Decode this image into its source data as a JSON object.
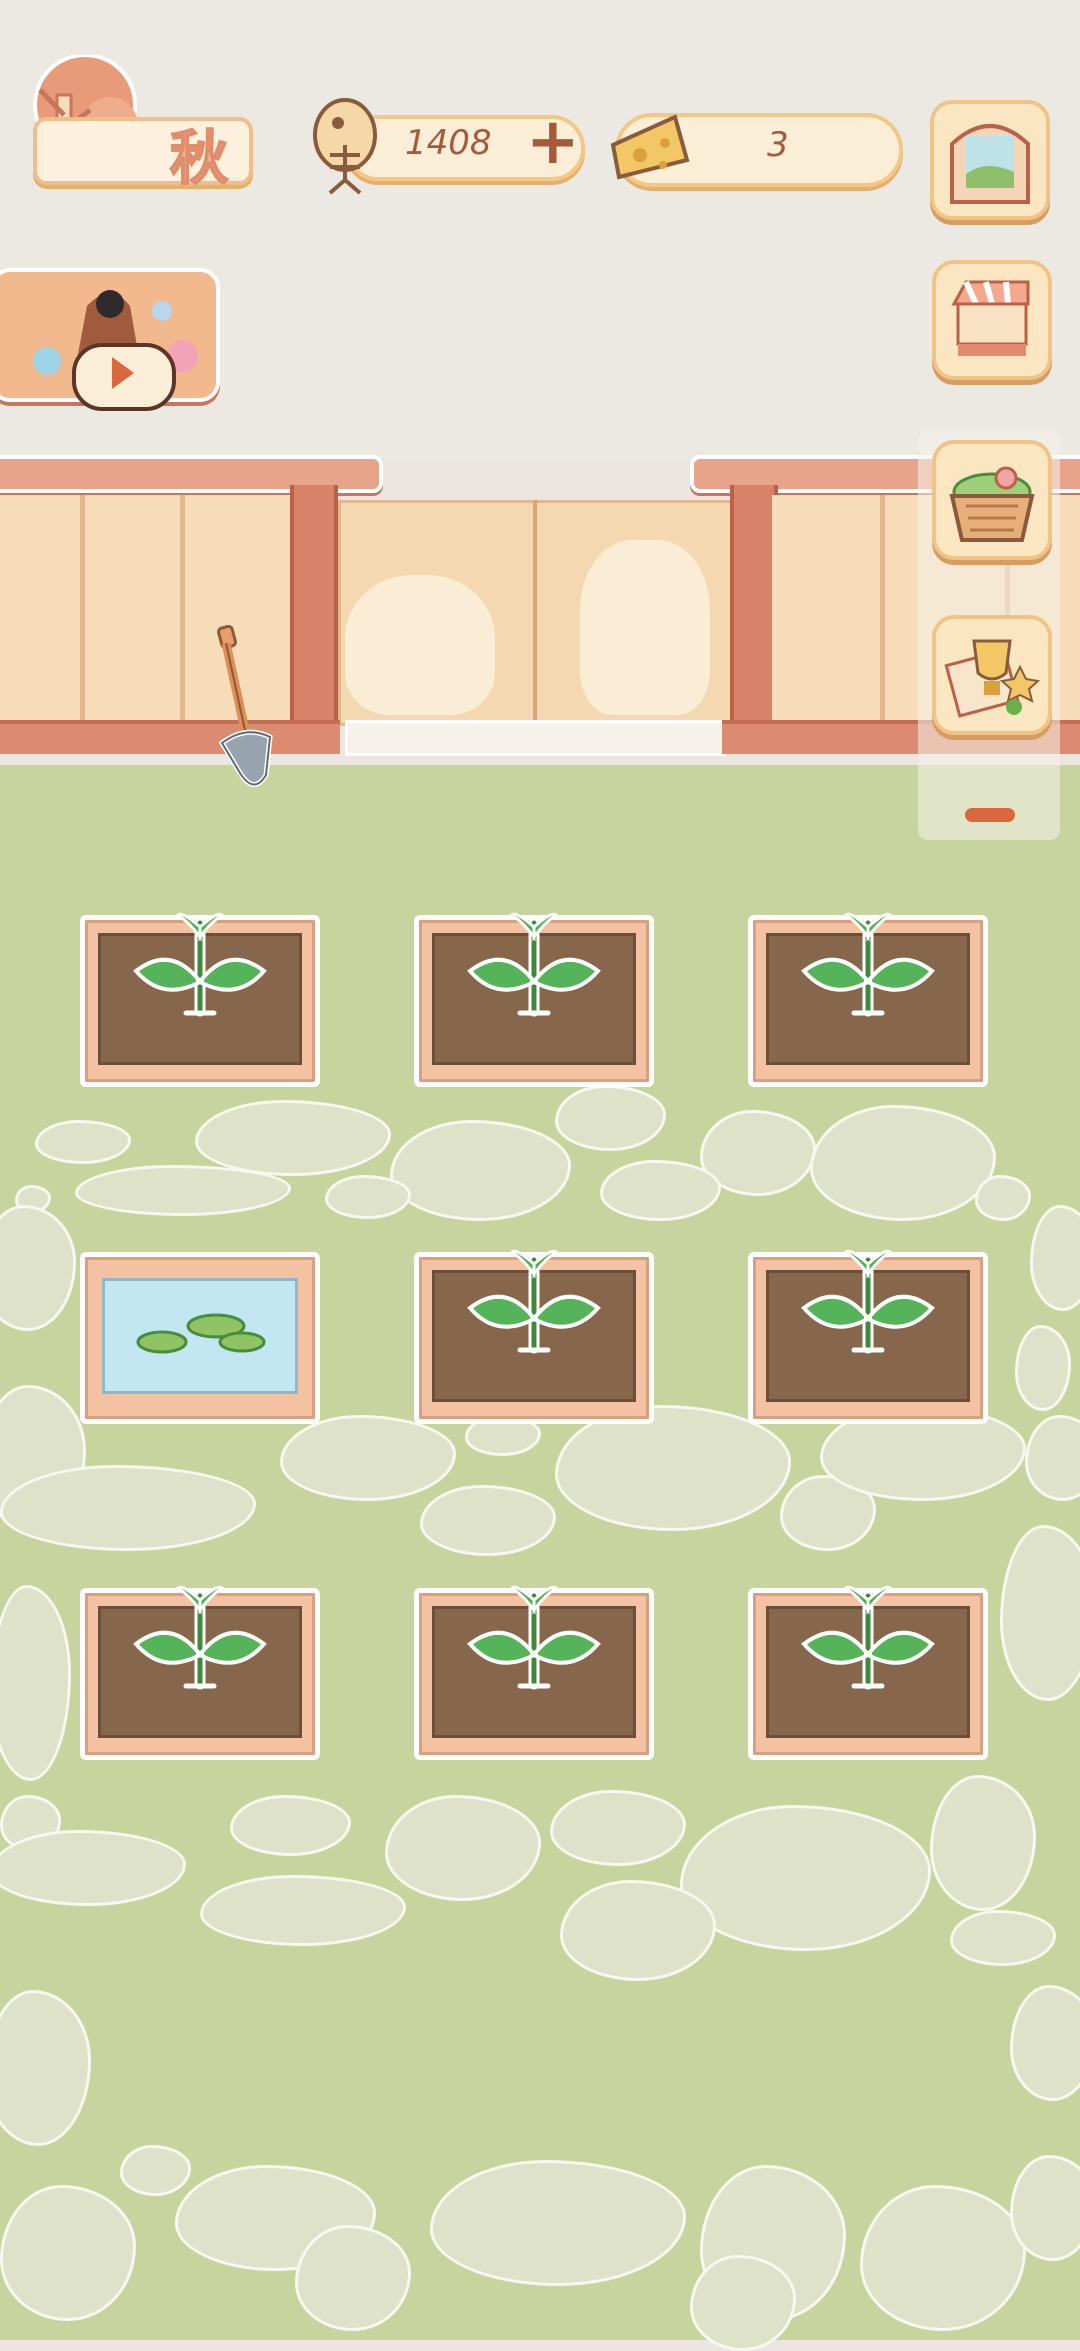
{
  "season": {
    "label": "秋"
  },
  "currency": {
    "fish_value": "1408",
    "add_label": "+",
    "cheese_value": "3"
  },
  "icons": {
    "fish": "fish-bone-icon",
    "cheese": "cheese-icon",
    "window": "window-icon",
    "shop": "shop-stall-icon",
    "basket": "basket-icon",
    "trophy": "trophy-icon",
    "shovel": "shovel-icon",
    "play": "play-icon"
  },
  "colors": {
    "accent": "#a45a3b",
    "lawn": "#c7d49d",
    "wall": "#f6ddb7",
    "soil": "#87674b"
  },
  "garden": {
    "plots": [
      {
        "content": "sprout"
      },
      {
        "content": "sprout"
      },
      {
        "content": "sprout"
      },
      {
        "content": "pond"
      },
      {
        "content": "sprout"
      },
      {
        "content": "sprout"
      },
      {
        "content": "sprout"
      },
      {
        "content": "sprout"
      },
      {
        "content": "sprout"
      }
    ]
  }
}
